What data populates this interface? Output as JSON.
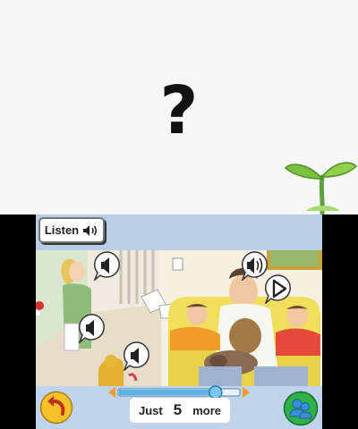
{
  "top_screen": {
    "prompt_glyph": "?"
  },
  "controls": {
    "listen_label": "Listen",
    "counter_prefix": "Just",
    "counter_value": "5",
    "counter_suffix": "more"
  },
  "scene": {
    "audio_hotspots": [
      {
        "icon": "speaker-icon"
      },
      {
        "icon": "speaker-playing-icon"
      },
      {
        "icon": "play-icon"
      },
      {
        "icon": "speaker-icon"
      },
      {
        "icon": "speaker-icon"
      }
    ]
  },
  "colors": {
    "panel_background": "#b9cde6",
    "sofa": "#f0df5a",
    "slider_fill": "#5ab4e8",
    "back_button": "#f3c22a",
    "friends_button": "#2fb24a"
  },
  "slider": {
    "progress_fraction": 0.8
  }
}
